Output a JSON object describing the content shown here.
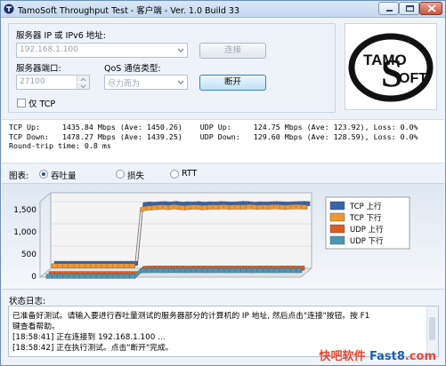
{
  "window": {
    "title": "TamoSoft Throughput Test - 客户端 - Ver. 1.0 Build 33"
  },
  "icons": {
    "app": "tamosoft-app-icon",
    "minimize": "minimize-icon",
    "maximize": "maximize-icon",
    "close": "close-icon"
  },
  "settings": {
    "server_ip_label": "服务器 IP 或 IPv6 地址:",
    "server_ip_value": "192.168.1.100",
    "connect_label": "连接",
    "server_port_label": "服务器端口:",
    "server_port_value": "27100",
    "qos_label": "QoS 通信类型:",
    "qos_value": "尽力而为",
    "disconnect_label": "断开",
    "ipv4_only_label": "仅 TCP",
    "ipv4_only_checked": false
  },
  "logo": {
    "line1": "TAMO",
    "line2": "OFT",
    "letter": "S"
  },
  "stats": {
    "lines": [
      "TCP Up:     1435.84 Mbps (Ave: 1450.26)    UDP Up:     124.75 Mbps (Ave: 123.92), Loss: 0.0%",
      "TCP Down:   1478.27 Mbps (Ave: 1439.25)    UDP Down:   129.60 Mbps (Ave: 128.59), Loss: 0.0%",
      "Round-trip time: 0.8 ms"
    ]
  },
  "graph_select": {
    "label": "图表:",
    "options": [
      "吞吐量",
      "损失",
      "RTT"
    ],
    "selected": "吞吐量"
  },
  "chart_data": {
    "type": "line",
    "y_ticks": [
      "1,500",
      "1,000",
      "500",
      "0"
    ],
    "ylim": [
      0,
      1700
    ],
    "series": [
      {
        "name": "TCP 上行",
        "color": "#3b63a7",
        "values": [
          110,
          110,
          110,
          110,
          110,
          110,
          110,
          110,
          110,
          110,
          110,
          110,
          110,
          110,
          110,
          110,
          1430,
          1445,
          1440,
          1450,
          1455,
          1445,
          1460,
          1440,
          1450,
          1445,
          1455,
          1440,
          1450,
          1445,
          1455,
          1450,
          1445,
          1450,
          1460,
          1455,
          1440,
          1450,
          1445,
          1450,
          1455,
          1450,
          1445,
          1450,
          1455,
          1460,
          1450
        ]
      },
      {
        "name": "TCP 下行",
        "color": "#f0982f",
        "values": [
          115,
          115,
          115,
          115,
          115,
          115,
          115,
          115,
          115,
          115,
          115,
          115,
          115,
          115,
          115,
          115,
          1380,
          1410,
          1420,
          1430,
          1440,
          1425,
          1445,
          1430,
          1420,
          1435,
          1440,
          1425,
          1430,
          1440,
          1435,
          1445,
          1430,
          1440,
          1435,
          1440,
          1445,
          1430,
          1440,
          1435,
          1445,
          1440,
          1430,
          1440,
          1445,
          1440,
          1435
        ]
      },
      {
        "name": "UDP 上行",
        "color": "#e05a1f",
        "values": [
          0,
          0,
          0,
          0,
          0,
          0,
          0,
          0,
          0,
          0,
          0,
          0,
          0,
          0,
          0,
          0,
          0,
          120,
          122,
          124,
          125,
          123,
          124,
          125,
          124,
          123,
          124,
          125,
          124,
          123,
          124,
          125,
          124,
          123,
          124,
          125,
          124,
          123,
          124,
          125,
          124,
          123,
          124,
          125,
          124,
          123,
          124
        ]
      },
      {
        "name": "UDP 下行",
        "color": "#4c97b6",
        "values": [
          0,
          0,
          0,
          0,
          0,
          0,
          0,
          0,
          0,
          0,
          0,
          0,
          0,
          0,
          0,
          0,
          0,
          126,
          128,
          129,
          130,
          128,
          129,
          130,
          129,
          128,
          129,
          130,
          129,
          128,
          129,
          130,
          129,
          128,
          129,
          130,
          129,
          128,
          129,
          130,
          129,
          128,
          129,
          130,
          129,
          128,
          129
        ]
      }
    ]
  },
  "log": {
    "label": "状态日志:",
    "lines": [
      "已准备好测试。请输入要进行吞吐量测试的服务器部分的计算机的 IP 地址, 然后点击\"连接\"按钮。按 F1",
      "键查看帮助。",
      "[18:58:41] 正在连接到 192.168.1.100 ...",
      "[18:58:42] 正在执行测试。点击\"断开\"完成。"
    ]
  },
  "watermark": {
    "part1": "快吧软件",
    "part2": " Fast8",
    "part3": ".com"
  }
}
